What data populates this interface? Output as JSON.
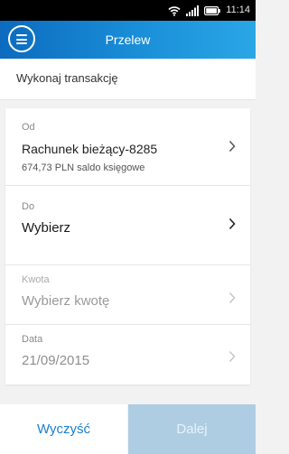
{
  "status_bar": {
    "time": "11:14",
    "icons": [
      "wifi-icon",
      "signal-icon",
      "battery-icon"
    ]
  },
  "app_bar": {
    "title": "Przelew",
    "menu_icon": "hamburger-menu-icon"
  },
  "subheader": {
    "text": "Wykonaj transakcję"
  },
  "form": {
    "from": {
      "label": "Od",
      "value": "Rachunek bieżący-8285",
      "balance": "674,73 PLN saldo księgowe"
    },
    "to": {
      "label": "Do",
      "value": "Wybierz"
    },
    "amount": {
      "label": "Kwota",
      "value": "Wybierz kwotę"
    },
    "date": {
      "label": "Data",
      "value": "21/09/2015"
    }
  },
  "footer": {
    "clear_label": "Wyczyść",
    "next_label": "Dalej"
  },
  "colors": {
    "appbar_start": "#0c6bbf",
    "appbar_end": "#2aa6e6",
    "accent": "#1a7fd0",
    "disabled_button": "#aecde3"
  }
}
